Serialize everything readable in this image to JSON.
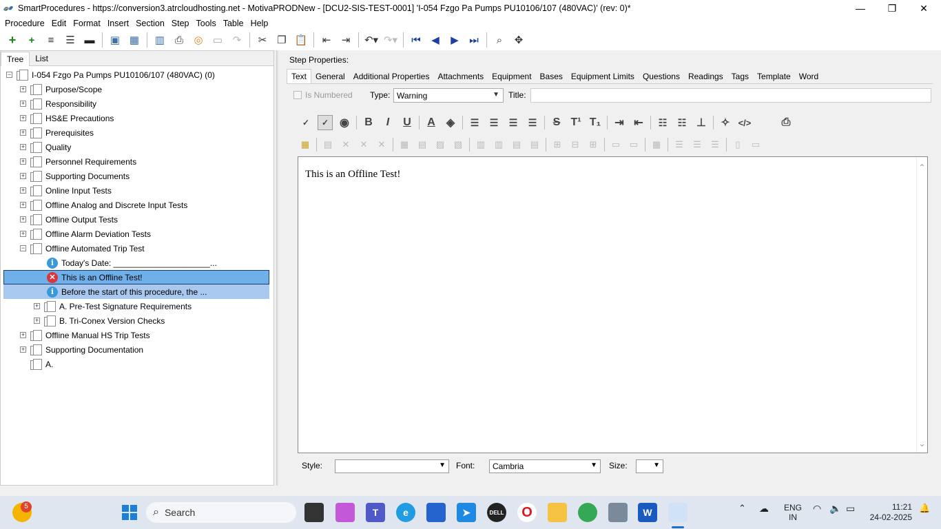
{
  "window": {
    "title": "SmartProcedures - https://conversion3.atrcloudhosting.net - MotivaPRODNew - [DCU2-SIS-TEST-0001] 'I-054 Fzgo Pa Pumps PU10106/107 (480VAC)' (rev: 0)*",
    "minimize": "—",
    "restore": "❐",
    "close": "✕"
  },
  "menu": [
    "Procedure",
    "Edit",
    "Format",
    "Insert",
    "Section",
    "Step",
    "Tools",
    "Table",
    "Help"
  ],
  "left_tabs": [
    "Tree",
    "List"
  ],
  "tree": {
    "root": "I-054 Fzgo Pa Pumps PU10106/107 (480VAC) (0)",
    "sections": [
      "Purpose/Scope",
      "Responsibility",
      "HS&E Precautions",
      "Prerequisites",
      "Quality",
      "Personnel Requirements",
      "Supporting Documents",
      "Online Input Tests",
      "Offline Analog and Discrete Input Tests",
      "Offline Output Tests",
      "Offline Alarm Deviation Tests",
      "Offline Automated Trip Test"
    ],
    "children": {
      "date": "Today's Date: _____________________...",
      "warning": "This is an Offline Test!",
      "info": "Before the start of this procedure, the ...",
      "sub_a": "A. Pre-Test Signature Requirements",
      "sub_b": "B. Tri-Conex Version Checks"
    },
    "sections_after": [
      "Offline Manual HS Trip Tests",
      "Supporting Documentation"
    ],
    "last": "A."
  },
  "step_props": {
    "heading": "Step Properties:",
    "tabs": [
      "Text",
      "General",
      "Additional Properties",
      "Attachments",
      "Equipment",
      "Bases",
      "Equipment Limits",
      "Questions",
      "Readings",
      "Tags",
      "Template",
      "Word"
    ],
    "is_numbered": "Is Numbered",
    "type_label": "Type:",
    "type_value": "Warning",
    "title_label": "Title:",
    "title_value": ""
  },
  "editor": {
    "text": "This is an Offline Test!"
  },
  "bottom": {
    "style_label": "Style:",
    "style_value": "",
    "font_label": "Font:",
    "font_value": "Cambria",
    "size_label": "Size:",
    "size_value": ""
  },
  "taskbar": {
    "search": "Search",
    "lang": "ENG",
    "region": "IN",
    "time": "11:21",
    "date": "24-02-2025",
    "badge": "5"
  }
}
